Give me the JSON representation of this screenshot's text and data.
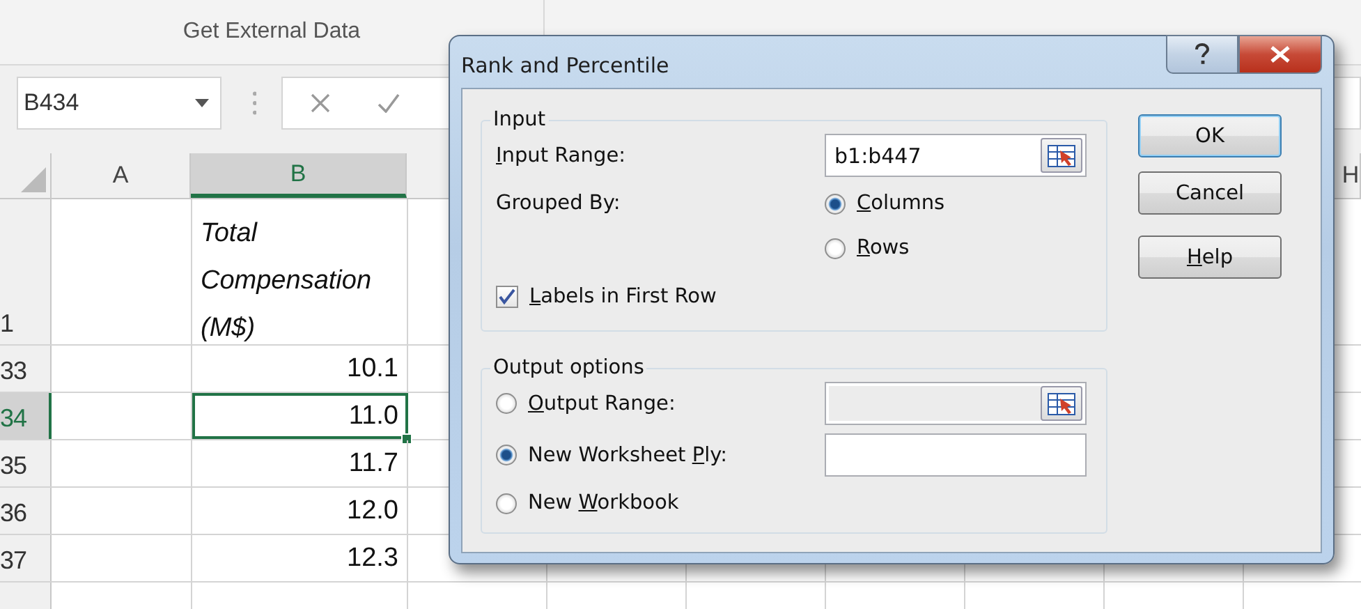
{
  "ribbon": {
    "group_label": "Get External Data"
  },
  "formula_bar": {
    "name_box": "B434"
  },
  "sheet": {
    "columns": [
      {
        "header": "A",
        "selected": false
      },
      {
        "header": "B",
        "selected": true
      },
      {
        "header": "H",
        "selected": false
      }
    ],
    "rows": [
      {
        "header": "1",
        "kind": "label",
        "cell_b": "Total Compensation (M$)",
        "selected": false
      },
      {
        "header": "33",
        "kind": "number",
        "cell_b": "10.1",
        "selected": false
      },
      {
        "header": "34",
        "kind": "number",
        "cell_b": "11.0",
        "selected": true
      },
      {
        "header": "35",
        "kind": "number",
        "cell_b": "11.7",
        "selected": false
      },
      {
        "header": "36",
        "kind": "number",
        "cell_b": "12.0",
        "selected": false
      },
      {
        "header": "37",
        "kind": "number",
        "cell_b": "12.3",
        "selected": false
      }
    ]
  },
  "dialog": {
    "title": "Rank and Percentile",
    "input_group": {
      "title": "Input",
      "input_range": {
        "label": {
          "key": "I",
          "after": "nput Range:"
        },
        "value": "b1:b447"
      },
      "grouped_by": {
        "label": {
          "before": "Grouped By:"
        },
        "options": [
          {
            "label": {
              "key": "C",
              "after": "olumns"
            },
            "selected": true
          },
          {
            "label": {
              "key": "R",
              "after": "ows"
            },
            "selected": false
          }
        ]
      },
      "labels_checkbox": {
        "label": {
          "key": "L",
          "after": "abels in First Row"
        },
        "checked": true
      }
    },
    "output_group": {
      "title": "Output options",
      "options": [
        {
          "label": {
            "key": "O",
            "after": "utput Range:"
          },
          "selected": false,
          "kind": "range",
          "disabled": true
        },
        {
          "label": {
            "before": "New Worksheet ",
            "key": "P",
            "after": "ly:"
          },
          "selected": true,
          "kind": "text",
          "disabled": false
        },
        {
          "label": {
            "before": "New ",
            "key": "W",
            "after": "orkbook"
          },
          "selected": false,
          "kind": "none"
        }
      ]
    },
    "buttons": [
      {
        "label": {
          "before": "OK"
        },
        "default": true
      },
      {
        "label": {
          "before": "Cancel"
        },
        "default": false
      },
      {
        "label": {
          "key": "H",
          "after": "elp"
        },
        "default": false
      }
    ]
  }
}
